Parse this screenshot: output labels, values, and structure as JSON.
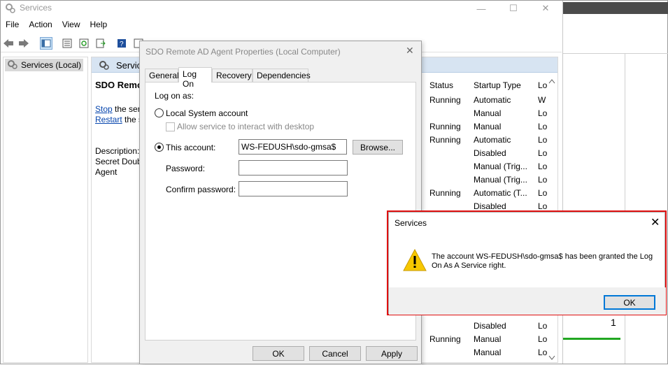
{
  "window": {
    "title": "Services",
    "minimize": "—",
    "maximize": "☐",
    "close": "✕"
  },
  "menu": [
    "File",
    "Action",
    "View",
    "Help"
  ],
  "tree": {
    "root": "Services (Local)"
  },
  "center": {
    "header": "Services",
    "selected_service": "SDO Remote",
    "stop_link": "Stop",
    "stop_rest": " the ser",
    "restart_link": "Restart",
    "restart_rest": " the s",
    "description_label": "Description:",
    "description_line1": "Secret Doub",
    "description_line2": "Agent"
  },
  "table": {
    "headers": [
      "Status",
      "Startup Type",
      "Lo"
    ],
    "rows": [
      {
        "status": "Running",
        "startup": "Automatic",
        "logon": "W"
      },
      {
        "status": "",
        "startup": "Manual",
        "logon": "Lo"
      },
      {
        "status": "Running",
        "startup": "Manual",
        "logon": "Lo"
      },
      {
        "status": "Running",
        "startup": "Automatic",
        "logon": "Lo"
      },
      {
        "status": "",
        "startup": "Disabled",
        "logon": "Lo"
      },
      {
        "status": "",
        "startup": "Manual (Trig...",
        "logon": "Lo"
      },
      {
        "status": "",
        "startup": "Manual (Trig...",
        "logon": "Lo"
      },
      {
        "status": "Running",
        "startup": "Automatic (T...",
        "logon": "Lo"
      },
      {
        "status": "",
        "startup": "Disabled",
        "logon": "Lo"
      }
    ],
    "bottom_rows": [
      {
        "status": "",
        "startup": "Disabled",
        "logon": "Lo"
      },
      {
        "status": "Running",
        "startup": "Manual",
        "logon": "Lo"
      },
      {
        "status": "",
        "startup": "Manual",
        "logon": "Lo"
      }
    ]
  },
  "right_panel": {
    "number": "1"
  },
  "properties": {
    "title": "SDO Remote AD Agent Properties (Local Computer)",
    "close": "✕",
    "tabs": [
      "General",
      "Log On",
      "Recovery",
      "Dependencies"
    ],
    "active_tab": "Log On",
    "log_on_as": "Log on as:",
    "local_system": "Local System account",
    "allow_interact": "Allow service to interact with desktop",
    "this_account": "This account:",
    "account_value": "WS-FEDUSH\\sdo-gmsa$",
    "browse": "Browse...",
    "password_label": "Password:",
    "confirm_label": "Confirm password:",
    "ok": "OK",
    "cancel": "Cancel",
    "apply": "Apply"
  },
  "message": {
    "title": "Services",
    "close": "✕",
    "text": "The account WS-FEDUSH\\sdo-gmsa$ has been granted the Log On As A Service right.",
    "ok": "OK",
    "highlight_color": "#e01010"
  }
}
